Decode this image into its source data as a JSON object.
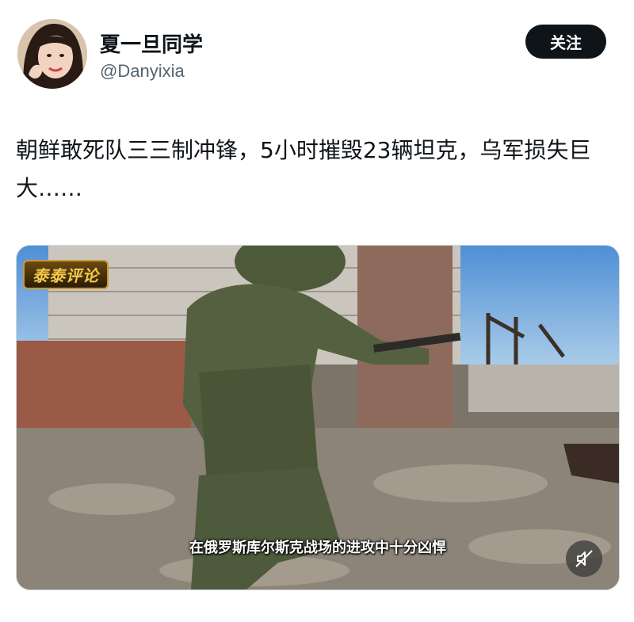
{
  "author": {
    "display_name": "夏一旦同学",
    "handle": "@Danyixia"
  },
  "follow_button": {
    "label": "关注"
  },
  "tweet": {
    "text": "朝鲜敢死队三三制冲锋，5小时摧毁23辆坦克，乌军损失巨大……"
  },
  "media": {
    "type": "video",
    "channel_logo_text": "泰泰评论",
    "subtitle": "在俄罗斯库尔斯克战场的进攻中十分凶悍",
    "mute_icon": "speaker-muted-icon"
  },
  "colors": {
    "text_primary": "#0f1419",
    "text_secondary": "#536471",
    "button_bg": "#0f1419",
    "button_text": "#ffffff",
    "media_border": "#cfd9de"
  }
}
